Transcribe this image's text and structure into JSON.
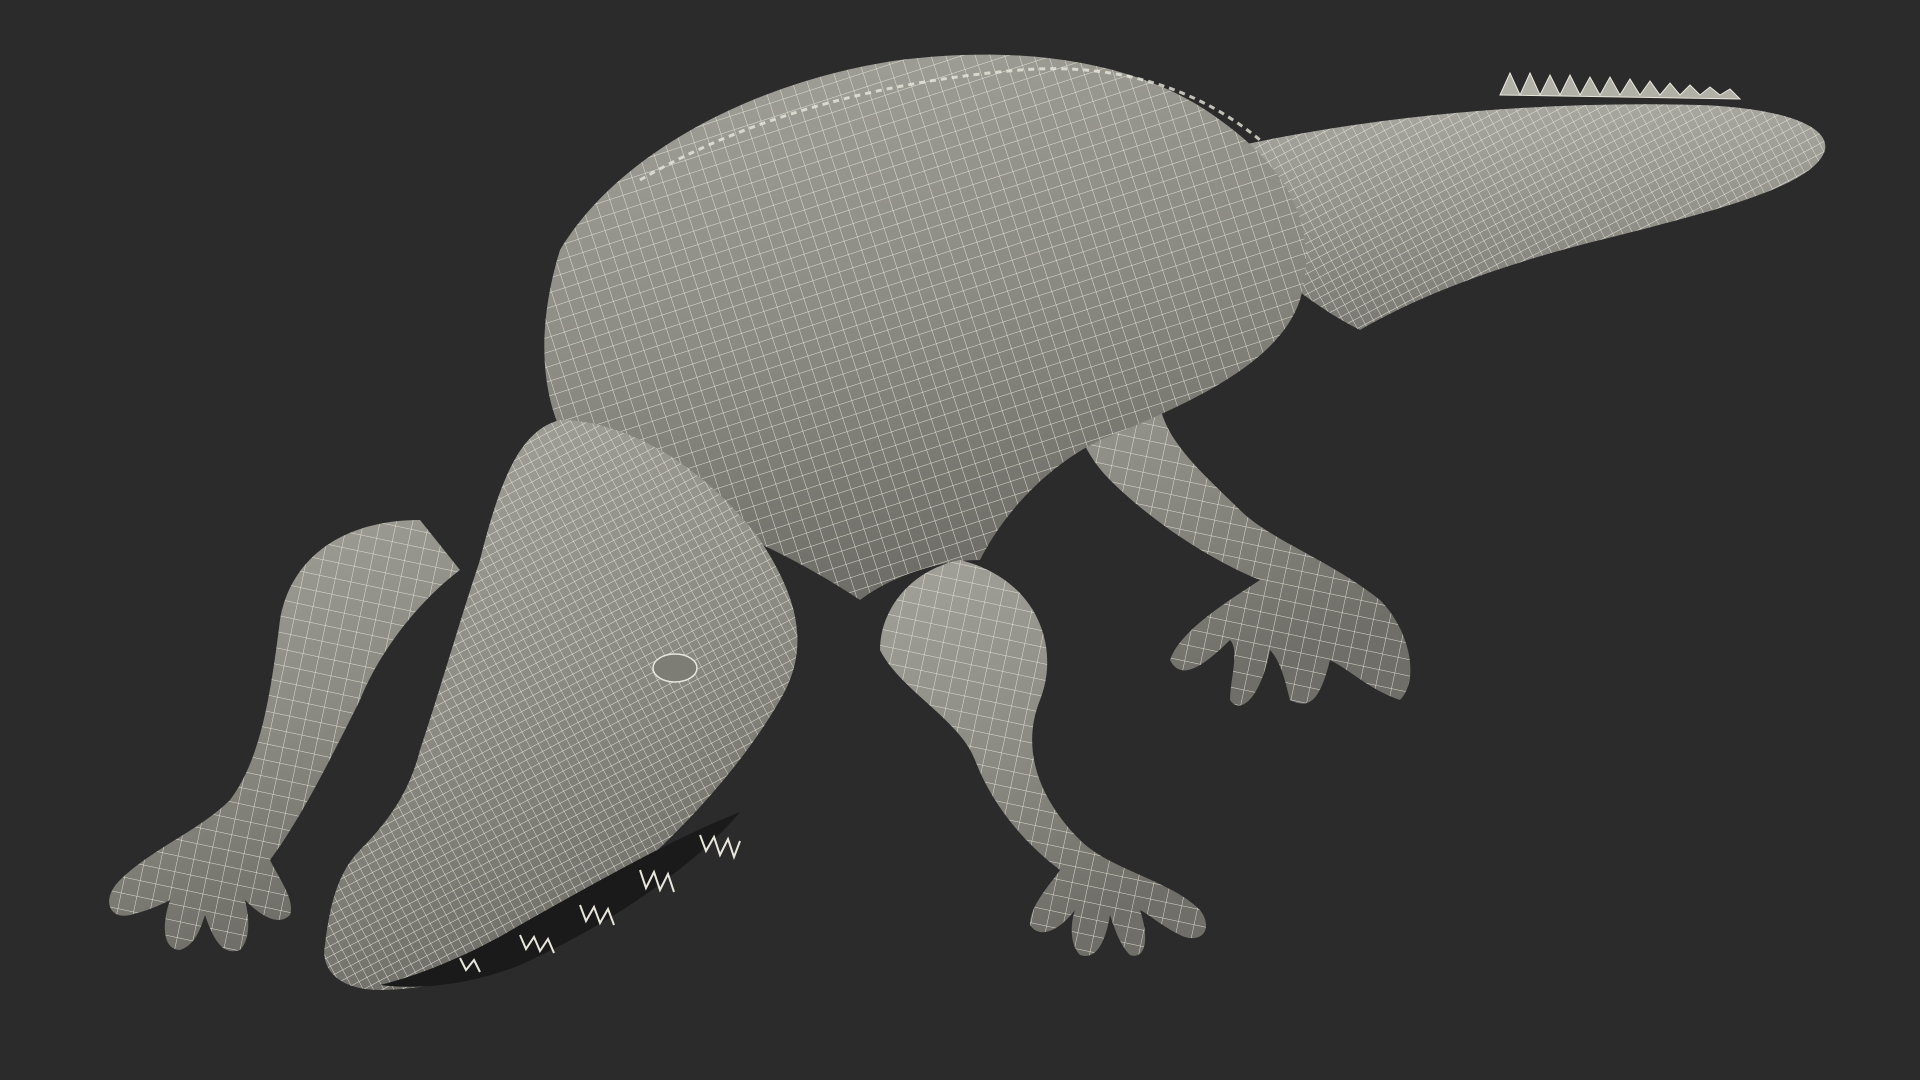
{
  "scene": {
    "subject": "crocodile-wireframe-model",
    "colors": {
      "background": "#2b2b2b",
      "body_fill": "#8c8b83",
      "body_shade": "#6f6e68",
      "body_light": "#a3a29a",
      "wire": "#e9e7dc",
      "mouth": "#1a1a1a",
      "teeth": "#e9e7dc"
    },
    "icons": []
  }
}
